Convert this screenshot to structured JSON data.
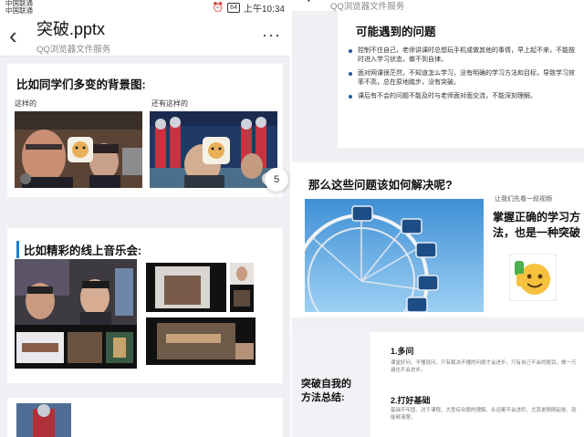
{
  "left": {
    "status": {
      "carrier1": "中国联通",
      "carrier2": "中国联通",
      "battery": "64",
      "time": "上午10:34"
    },
    "appbar": {
      "title": "突破.pptx",
      "subtitle": "QQ浏览器文件服务",
      "more": "···"
    },
    "slide1": {
      "heading": "比如同学们多变的背景图:",
      "caption_left": "这样的",
      "caption_right": "还有这样的"
    },
    "page_indicator": "5",
    "slide2": {
      "heading": "比如精彩的线上音乐会:"
    }
  },
  "right": {
    "header_subtitle": "QQ浏览器文件服务",
    "slide1": {
      "heading": "可能遇到的问题",
      "bullets": [
        "控制不住自己，老师讲课时总想玩手机或做其他的事情，早上起不来，不能按时进入学习状态，做不到自律。",
        "面对网课很茫然，不知道怎么学习，没有明确的学习方法和目标，导致学习效率不高，总在原地踏步，没有突破。",
        "课后有不会的问题不能及时与老师面对面交流，不能深刻理解。"
      ]
    },
    "slide2": {
      "heading": "那么这些问题该如何解决呢?",
      "hint": "让我们先看一段视频",
      "line1": "掌握正确的学习方",
      "line2": "法，也是一种突破"
    },
    "slide3": {
      "side_line1": "突破自我的",
      "side_line2": "方法总结:",
      "item1_title": "1.多问",
      "item1_text": "课堂好问、不懂就问，只有解决不懂的问题才会进步。只有自己不会的题目，做一万遍也不会进步。",
      "item2_title": "2.打好基础",
      "item2_text": "基础不牢固、对于课程、大型综合题的理解、永远都不会进阶，尤其是刚刚起卷、就能够清楚。"
    }
  },
  "colors": {
    "accent_blue": "#1a7fd8",
    "page_bg": "#eef0f3"
  }
}
